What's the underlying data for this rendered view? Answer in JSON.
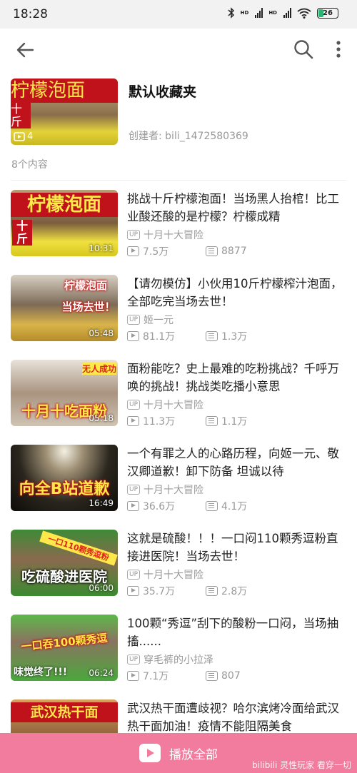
{
  "status_bar": {
    "time": "18:28",
    "battery": "26",
    "battery_fraction": 0.26
  },
  "colors": {
    "accent": "#f27c9d",
    "muted": "#999999"
  },
  "icons": [
    "bluetooth-icon",
    "signal-icon",
    "wifi-icon",
    "battery-icon",
    "back-arrow-icon",
    "search-icon",
    "more-icon",
    "play-count-icon",
    "danmaku-icon",
    "tv-play-icon"
  ],
  "folder": {
    "name": "默认收藏夹",
    "creator": "创建者: bili_1472580369",
    "cover_count": "4",
    "cover_caption": "柠檬泡面",
    "cover_caption2": "十斤"
  },
  "content_count": "8个内容",
  "up_tag": "UP",
  "videos": [
    {
      "title": "挑战十斤柠檬泡面！当场黑人抬棺！比工业酸还酸的是柠檬？柠檬成精",
      "uploader": "十月十大冒险",
      "views": "7.5万",
      "danmaku": "8877",
      "duration": "10:31",
      "caption": "柠檬泡面",
      "caption2": "十斤"
    },
    {
      "title": "【请勿模仿】小伙用10斤柠檬榨汁泡面，全部吃完当场去世！",
      "uploader": "姬一元",
      "views": "81.1万",
      "danmaku": "1.3万",
      "duration": "05:48",
      "caption": "柠檬泡面",
      "caption2": "当场去世！"
    },
    {
      "title": "面粉能吃？史上最难的吃粉挑战？千呼万唤的挑战！挑战类吃播小意思",
      "uploader": "十月十大冒险",
      "views": "11.3万",
      "danmaku": "1.1万",
      "duration": "05:18",
      "caption": "十月十吃面粉",
      "caption2": "无人成功"
    },
    {
      "title": "一个有罪之人的心路历程，向姬一元、敬汉卿道歉！卸下防备 坦诚以待",
      "uploader": "十月十大冒险",
      "views": "36.6万",
      "danmaku": "4.1万",
      "duration": "16:49",
      "caption": "向全B站道歉"
    },
    {
      "title": "这就是硫酸！！！一口闷110颗秀逗粉直接进医院！当场去世！",
      "uploader": "十月十大冒险",
      "views": "35.7万",
      "danmaku": "2.8万",
      "duration": "06:00",
      "caption": "吃硫酸进医院",
      "caption2": "一口110颗秀逗粉"
    },
    {
      "title": "100颗“秀逗”刮下的酸粉一口闷，当场抽搐......",
      "uploader": "穿毛裤的小拉泽",
      "views": "7.1万",
      "danmaku": "807",
      "duration": "06:24",
      "caption": "一口吞100颗秀逗",
      "caption2": "味觉终了!!!"
    },
    {
      "title": "武汉热干面遭歧视？哈尔滨烤冷面给武汉热干面加油！疫情不能阻隔美食",
      "uploader": "",
      "views": "",
      "danmaku": "",
      "duration": "",
      "caption": "武汉热干面"
    }
  ],
  "play_all": "播放全部",
  "watermark": "bilibili 灵性玩家 看穿一切"
}
